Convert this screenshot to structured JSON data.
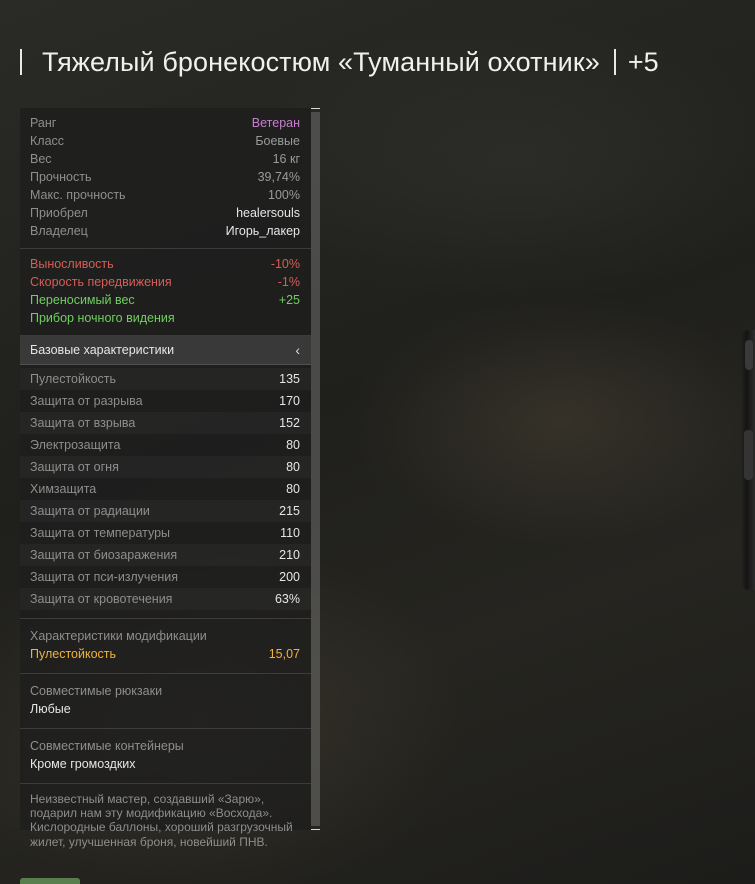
{
  "item": {
    "name": "Тяжелый бронекостюм «Туманный охотник»",
    "level": "+5"
  },
  "info": [
    {
      "key": "Ранг",
      "value": "Ветеран",
      "color": "purple"
    },
    {
      "key": "Класс",
      "value": "Боевые",
      "color": "gray"
    },
    {
      "key": "Вес",
      "value": "16 кг",
      "color": "gray"
    },
    {
      "key": "Прочность",
      "value": "39,74%",
      "color": "gray"
    },
    {
      "key": "Макс. прочность",
      "value": "100%",
      "color": "gray"
    },
    {
      "key": "Приобрел",
      "value": "healersouls",
      "color": "white"
    },
    {
      "key": "Владелец",
      "value": "Игорь_лакер",
      "color": "white"
    }
  ],
  "effects": [
    {
      "key": "Выносливость",
      "value": "-10%",
      "color": "red"
    },
    {
      "key": "Скорость передвижения",
      "value": "-1%",
      "color": "red"
    },
    {
      "key": "Переносимый вес",
      "value": "+25",
      "color": "green"
    },
    {
      "key": "Прибор ночного видения",
      "value": "",
      "color": "green"
    }
  ],
  "base_stats": {
    "header": "Базовые характеристики",
    "toggle_icon": "‹",
    "rows": [
      {
        "key": "Пулестойкость",
        "value": "135"
      },
      {
        "key": "Защита от разрыва",
        "value": "170"
      },
      {
        "key": "Защита от взрыва",
        "value": "152"
      },
      {
        "key": "Электрозащита",
        "value": "80"
      },
      {
        "key": "Защита от огня",
        "value": "80"
      },
      {
        "key": "Химзащита",
        "value": "80"
      },
      {
        "key": "Защита от радиации",
        "value": "215"
      },
      {
        "key": "Защита от температуры",
        "value": "110"
      },
      {
        "key": "Защита от биозаражения",
        "value": "210"
      },
      {
        "key": "Защита от пси-излучения",
        "value": "200"
      },
      {
        "key": "Защита от кровотечения",
        "value": "63%"
      }
    ]
  },
  "mod_stats": {
    "title": "Характеристики модификации",
    "key": "Пулестойкость",
    "value": "15,07"
  },
  "backpacks": {
    "title": "Совместимые рюкзаки",
    "value": "Любые"
  },
  "containers": {
    "title": "Совместимые контейнеры",
    "value": "Кроме громоздких"
  },
  "description": "Неизвестный мастер, создавший «Зарю», подарил нам эту модификацию «Восхода». Кислородные баллоны, хороший разгрузочный жилет, улучшенная броня, новейший ПНВ."
}
